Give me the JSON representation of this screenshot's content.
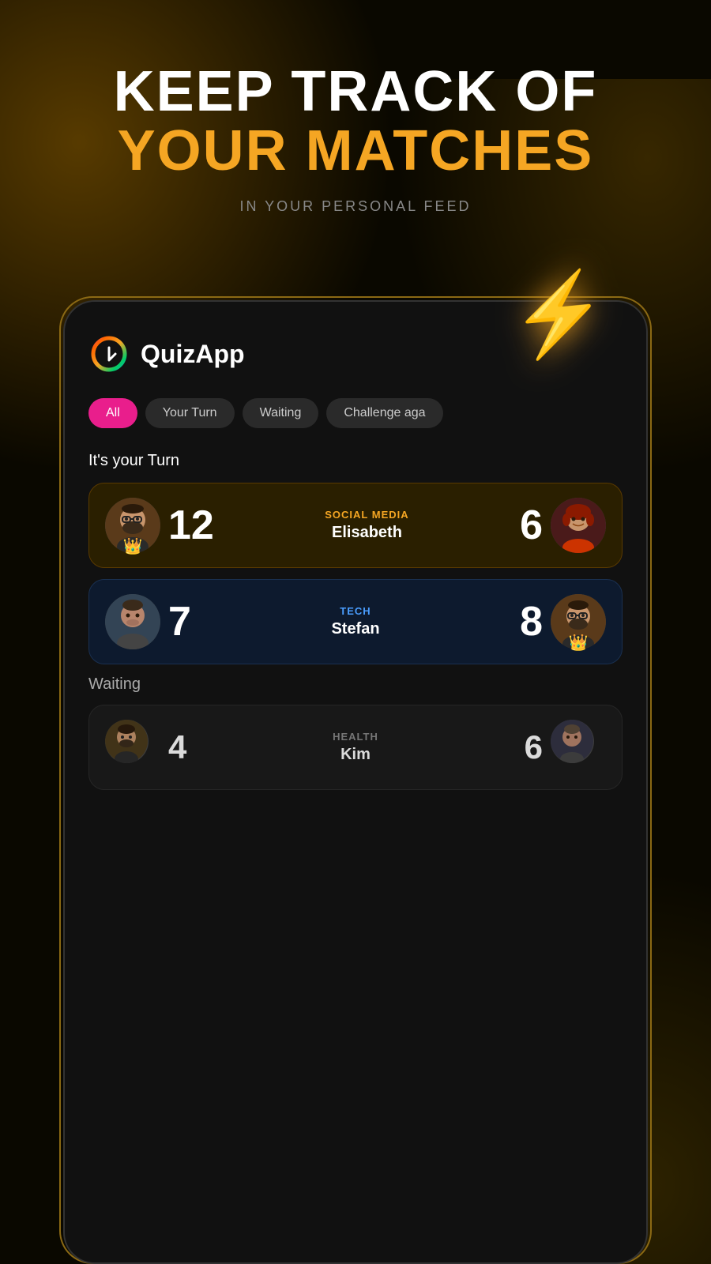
{
  "background": {
    "color": "#0a0800"
  },
  "header": {
    "line1": "KEEP TRACK OF",
    "line2": "YOUR MATCHES",
    "subtitle": "IN YOUR PERSONAL FEED"
  },
  "app": {
    "name": "QuizApp",
    "logo_colors": [
      "#e91e8c",
      "#ff6600",
      "#f5a623",
      "#00cc66",
      "#3399ff",
      "#9933ff"
    ]
  },
  "tabs": [
    {
      "label": "All",
      "active": true
    },
    {
      "label": "Your Turn",
      "active": false
    },
    {
      "label": "Waiting",
      "active": false
    },
    {
      "label": "Challenge aga",
      "active": false
    }
  ],
  "its_your_turn_label": "It's your Turn",
  "matches_your_turn": [
    {
      "player_score": "12",
      "category": "SOCIAL MEDIA",
      "opponent_name": "Elisabeth",
      "opponent_score": "6",
      "player_has_crown": true,
      "opponent_has_crown": false,
      "card_type": "gold"
    },
    {
      "player_score": "7",
      "category": "TECH",
      "opponent_name": "Stefan",
      "opponent_score": "8",
      "player_has_crown": false,
      "opponent_has_crown": true,
      "card_type": "blue"
    }
  ],
  "waiting_label": "Waiting",
  "matches_waiting": [
    {
      "player_score": "4",
      "category": "HEALTH",
      "opponent_name": "Kim",
      "opponent_score": "6",
      "player_has_crown": false,
      "opponent_has_crown": false,
      "card_type": "dark"
    }
  ],
  "lightning_icon": "⚡"
}
